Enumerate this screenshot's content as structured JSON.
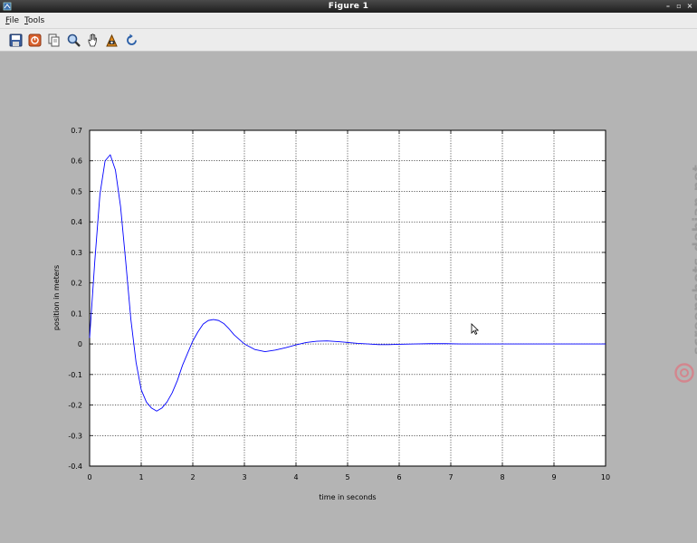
{
  "window": {
    "title": "Figure 1",
    "controls": [
      "–",
      "▫",
      "×"
    ]
  },
  "menubar": {
    "items": [
      {
        "key": "F",
        "rest": "ile"
      },
      {
        "key": "T",
        "rest": "ools"
      }
    ]
  },
  "toolbar": {
    "tools": [
      {
        "icon": "save-icon"
      },
      {
        "icon": "stop-icon"
      },
      {
        "icon": "copy-icon"
      },
      {
        "icon": "zoom-icon"
      },
      {
        "icon": "pan-hand-icon"
      },
      {
        "icon": "rotate-camera-icon"
      },
      {
        "icon": "reset-view-icon"
      }
    ]
  },
  "colors": {
    "line": "#0000ff",
    "figure_bg": "#b4b4b4",
    "axes_bg": "#ffffff",
    "grid": "#000000"
  },
  "chart_data": {
    "type": "line",
    "title": "",
    "xlabel": "time in seconds",
    "ylabel": "position in meters",
    "xlim": [
      0,
      10
    ],
    "ylim": [
      -0.4,
      0.7
    ],
    "xticks": [
      "0",
      "1",
      "2",
      "3",
      "4",
      "5",
      "6",
      "7",
      "8",
      "9",
      "10"
    ],
    "yticks": [
      "-0.4",
      "-0.3",
      "-0.2",
      "-0.1",
      "0",
      "0.1",
      "0.2",
      "0.3",
      "0.4",
      "0.5",
      "0.6",
      "0.7"
    ],
    "grid": true,
    "series": [
      {
        "name": "",
        "x": [
          0,
          0.1,
          0.2,
          0.3,
          0.4,
          0.5,
          0.6,
          0.7,
          0.8,
          0.9,
          1.0,
          1.1,
          1.2,
          1.3,
          1.4,
          1.5,
          1.6,
          1.7,
          1.8,
          1.9,
          2.0,
          2.1,
          2.2,
          2.3,
          2.4,
          2.5,
          2.6,
          2.7,
          2.8,
          2.9,
          3.0,
          3.2,
          3.4,
          3.6,
          3.8,
          4.0,
          4.2,
          4.4,
          4.6,
          4.8,
          5.0,
          5.2,
          5.4,
          5.6,
          5.8,
          6.0,
          6.3,
          6.6,
          6.9,
          7.2,
          7.6,
          8.0,
          8.5,
          9.0,
          9.5,
          10.0
        ],
        "y": [
          0.02,
          0.27,
          0.49,
          0.6,
          0.62,
          0.57,
          0.45,
          0.27,
          0.08,
          -0.06,
          -0.15,
          -0.19,
          -0.21,
          -0.22,
          -0.21,
          -0.19,
          -0.16,
          -0.12,
          -0.07,
          -0.03,
          0.01,
          0.04,
          0.065,
          0.077,
          0.08,
          0.077,
          0.067,
          0.05,
          0.03,
          0.015,
          0.0,
          -0.018,
          -0.025,
          -0.02,
          -0.012,
          -0.003,
          0.005,
          0.009,
          0.01,
          0.008,
          0.005,
          0.002,
          0.0,
          -0.002,
          -0.002,
          -0.001,
          0.0,
          0.001,
          0.001,
          0.0,
          0.0,
          0.0,
          0.0,
          0.0,
          0.0,
          0.0
        ]
      }
    ]
  },
  "watermark": {
    "text": "screenshots.debian.net"
  }
}
